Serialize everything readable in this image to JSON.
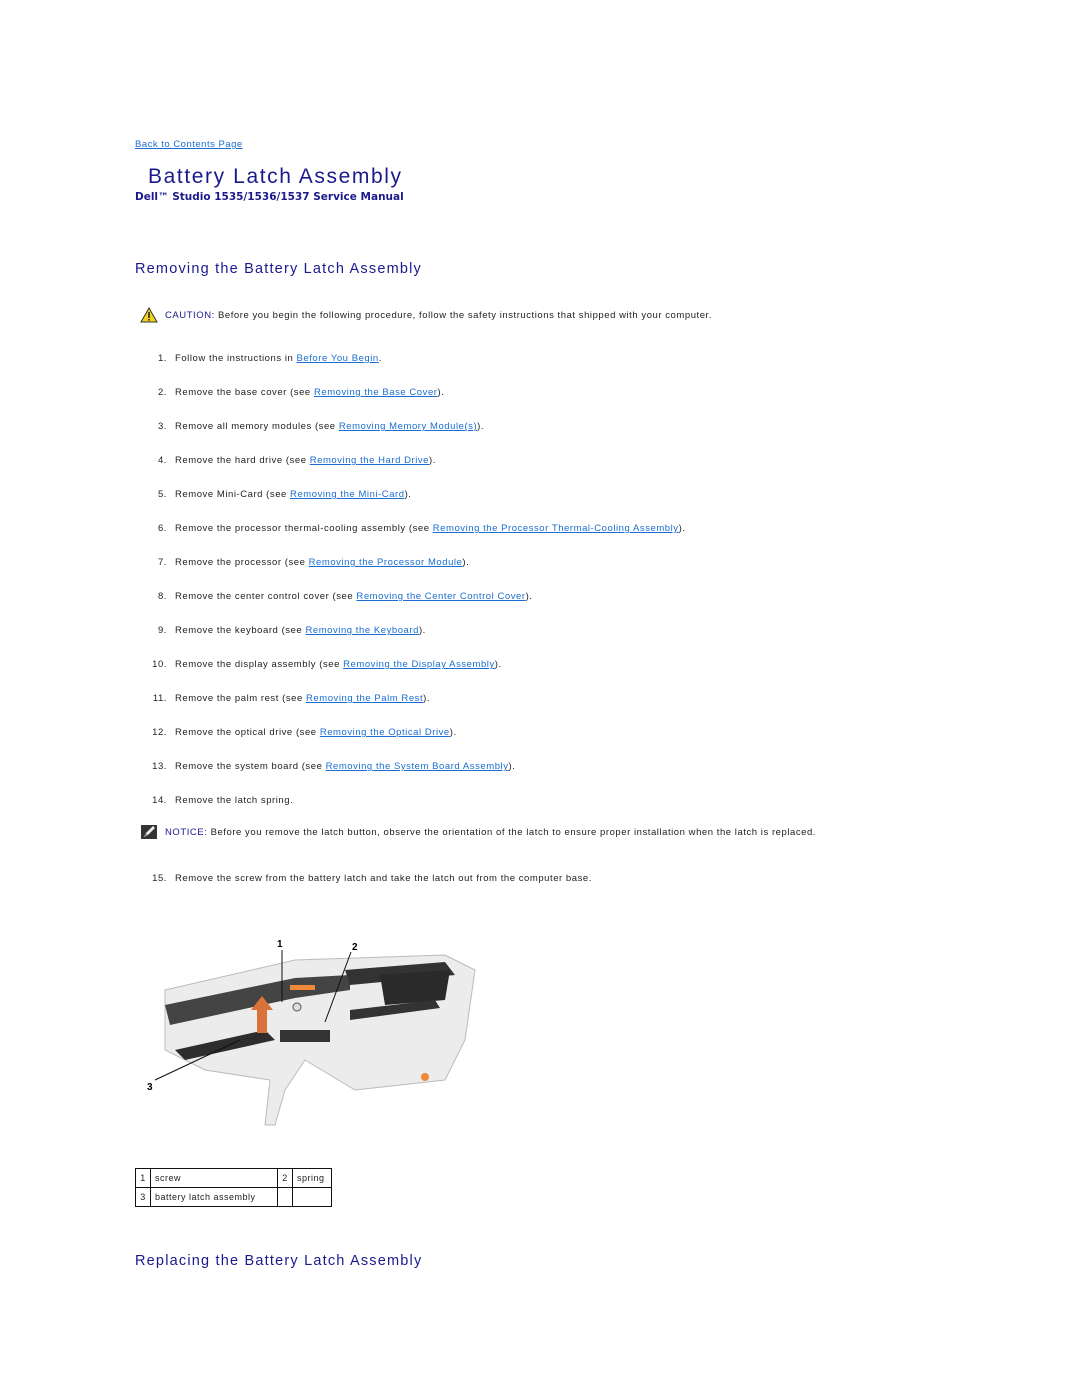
{
  "nav": {
    "back_link": "Back to Contents Page"
  },
  "header": {
    "title": "Battery Latch Assembly",
    "subtitle": "Dell™ Studio 1535/1536/1537 Service Manual"
  },
  "removing": {
    "heading": "Removing the Battery Latch Assembly",
    "caution": {
      "icon": "warning-triangle-icon",
      "label": "CAUTION:",
      "text": " Before you begin the following procedure, follow the safety instructions that shipped with your computer."
    },
    "steps": [
      {
        "num": "1.",
        "pre": "Follow the instructions in ",
        "link": "Before You Begin",
        "post": "."
      },
      {
        "num": "2.",
        "pre": "Remove the base cover (see ",
        "link": "Removing the Base Cover",
        "post": ")."
      },
      {
        "num": "3.",
        "pre": "Remove all memory modules (see ",
        "link": "Removing Memory Module(s)",
        "post": ")."
      },
      {
        "num": "4.",
        "pre": "Remove the hard drive (see ",
        "link": "Removing the Hard Drive",
        "post": ")."
      },
      {
        "num": "5.",
        "pre": "Remove Mini-Card (see ",
        "link": "Removing the Mini-Card",
        "post": ")."
      },
      {
        "num": "6.",
        "pre": "Remove the processor thermal-cooling assembly (see ",
        "link": "Removing the Processor Thermal-Cooling Assembly",
        "post": ")."
      },
      {
        "num": "7.",
        "pre": "Remove the processor (see ",
        "link": "Removing the Processor Module",
        "post": ")."
      },
      {
        "num": "8.",
        "pre": "Remove the center control cover (see ",
        "link": "Removing the Center Control Cover",
        "post": ")."
      },
      {
        "num": "9.",
        "pre": "Remove the keyboard (see ",
        "link": "Removing the Keyboard",
        "post": ")."
      },
      {
        "num": "10.",
        "pre": "Remove the display assembly (see ",
        "link": "Removing the Display Assembly",
        "post": ")."
      },
      {
        "num": "11.",
        "pre": "Remove the palm rest (see ",
        "link": "Removing the Palm Rest",
        "post": ")."
      },
      {
        "num": "12.",
        "pre": "Remove the optical drive (see ",
        "link": "Removing the Optical Drive",
        "post": ")."
      },
      {
        "num": "13.",
        "pre": "Remove the system board (see ",
        "link": "Removing the System Board Assembly",
        "post": ")."
      },
      {
        "num": "14.",
        "pre": "Remove the latch spring.",
        "link": null,
        "post": ""
      }
    ],
    "notice": {
      "icon": "pencil-notice-icon",
      "label": "NOTICE:",
      "text": " Before you remove the latch button, observe the orientation of the latch to ensure proper installation when the latch is replaced."
    },
    "step15": {
      "num": "15.",
      "text": "Remove the screw from the battery latch and take the latch out from the computer base."
    },
    "figure": {
      "callout_1": "1",
      "callout_2": "2",
      "callout_3": "3"
    },
    "callouts_table": [
      [
        {
          "n": "1",
          "label": "screw"
        },
        {
          "n": "2",
          "label": "spring"
        }
      ],
      [
        {
          "n": "3",
          "label": "battery latch assembly"
        },
        {
          "n": "",
          "label": ""
        }
      ]
    ]
  },
  "replacing": {
    "heading": "Replacing the Battery Latch Assembly"
  },
  "colors": {
    "heading": "#1a1a8c",
    "link": "#1a6dd1",
    "text": "#222222"
  }
}
